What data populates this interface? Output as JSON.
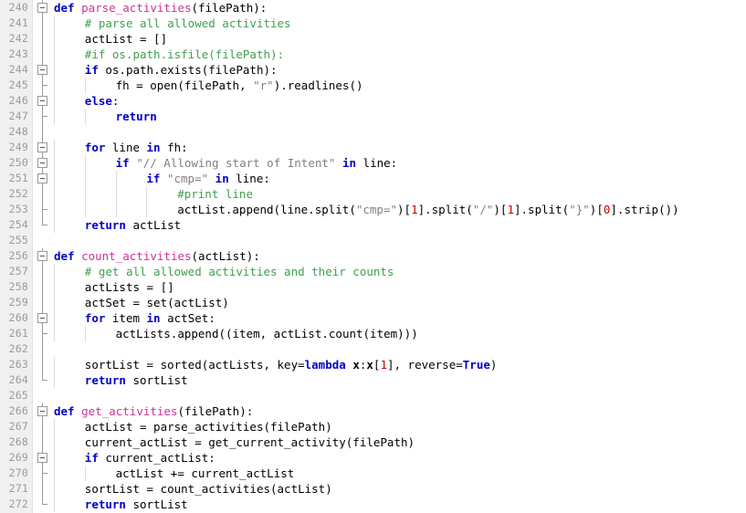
{
  "editor": {
    "name": "code-editor",
    "language": "python",
    "first_line": 240,
    "last_line": 272,
    "line_height_px": 17,
    "colors": {
      "background": "#ffffff",
      "gutter_background": "#f0f0f0",
      "line_number": "#9a9a9a",
      "keyword": "#0000cc",
      "function_name": "#cc3399",
      "comment": "#3f9f4f",
      "string": "#808080",
      "number": "#cc0000",
      "plain_text": "#000000",
      "indent_guide": "#dcdcdc",
      "fold_line": "#999999"
    }
  },
  "lines": [
    {
      "number": "240",
      "indent": 0,
      "fold": "box",
      "tokens": [
        {
          "t": "def ",
          "c": "kw"
        },
        {
          "t": "parse_activities",
          "c": "fname"
        },
        {
          "t": "(filePath):",
          "c": "pln"
        }
      ]
    },
    {
      "number": "241",
      "indent": 1,
      "fold": "line",
      "tokens": [
        {
          "t": "# parse all allowed activities",
          "c": "cmt"
        }
      ]
    },
    {
      "number": "242",
      "indent": 1,
      "fold": "line",
      "tokens": [
        {
          "t": "actList = []",
          "c": "pln"
        }
      ]
    },
    {
      "number": "243",
      "indent": 1,
      "fold": "line",
      "tokens": [
        {
          "t": "#if os.path.isfile(filePath):",
          "c": "cmt"
        }
      ]
    },
    {
      "number": "244",
      "indent": 1,
      "fold": "box",
      "tokens": [
        {
          "t": "if",
          "c": "kw"
        },
        {
          "t": " os.path.exists(filePath):",
          "c": "pln"
        }
      ]
    },
    {
      "number": "245",
      "indent": 2,
      "fold": "tick",
      "tokens": [
        {
          "t": "fh = open(filePath, ",
          "c": "pln"
        },
        {
          "t": "\"r\"",
          "c": "str"
        },
        {
          "t": ").readlines()",
          "c": "pln"
        }
      ]
    },
    {
      "number": "246",
      "indent": 1,
      "fold": "box",
      "tokens": [
        {
          "t": "else",
          "c": "kw"
        },
        {
          "t": ":",
          "c": "pln"
        }
      ]
    },
    {
      "number": "247",
      "indent": 2,
      "fold": "tick",
      "tokens": [
        {
          "t": "return",
          "c": "kw"
        }
      ]
    },
    {
      "number": "248",
      "indent": 0,
      "fold": "line",
      "tokens": []
    },
    {
      "number": "249",
      "indent": 1,
      "fold": "box",
      "tokens": [
        {
          "t": "for",
          "c": "kw"
        },
        {
          "t": " line ",
          "c": "pln"
        },
        {
          "t": "in",
          "c": "kw"
        },
        {
          "t": " fh:",
          "c": "pln"
        }
      ]
    },
    {
      "number": "250",
      "indent": 2,
      "fold": "box",
      "tokens": [
        {
          "t": "if",
          "c": "kw"
        },
        {
          "t": " ",
          "c": "pln"
        },
        {
          "t": "\"// Allowing start of Intent\"",
          "c": "str"
        },
        {
          "t": " ",
          "c": "pln"
        },
        {
          "t": "in",
          "c": "kw"
        },
        {
          "t": " line:",
          "c": "pln"
        }
      ]
    },
    {
      "number": "251",
      "indent": 3,
      "fold": "box",
      "tokens": [
        {
          "t": "if",
          "c": "kw"
        },
        {
          "t": " ",
          "c": "pln"
        },
        {
          "t": "\"cmp=\"",
          "c": "str"
        },
        {
          "t": " ",
          "c": "pln"
        },
        {
          "t": "in",
          "c": "kw"
        },
        {
          "t": " line:",
          "c": "pln"
        }
      ]
    },
    {
      "number": "252",
      "indent": 4,
      "fold": "line",
      "tokens": [
        {
          "t": "#print line",
          "c": "cmt"
        }
      ]
    },
    {
      "number": "253",
      "indent": 4,
      "fold": "tick",
      "tokens": [
        {
          "t": "actList.append(line.split(",
          "c": "pln"
        },
        {
          "t": "\"cmp=\"",
          "c": "str"
        },
        {
          "t": ")[",
          "c": "pln"
        },
        {
          "t": "1",
          "c": "num"
        },
        {
          "t": "].split(",
          "c": "pln"
        },
        {
          "t": "\"/\"",
          "c": "str"
        },
        {
          "t": ")[",
          "c": "pln"
        },
        {
          "t": "1",
          "c": "num"
        },
        {
          "t": "].split(",
          "c": "pln"
        },
        {
          "t": "\"}\"",
          "c": "str"
        },
        {
          "t": ")[",
          "c": "pln"
        },
        {
          "t": "0",
          "c": "num"
        },
        {
          "t": "].strip())",
          "c": "pln"
        }
      ]
    },
    {
      "number": "254",
      "indent": 1,
      "fold": "end",
      "tokens": [
        {
          "t": "return",
          "c": "kw"
        },
        {
          "t": " actList",
          "c": "pln"
        }
      ]
    },
    {
      "number": "255",
      "indent": 0,
      "fold": "none",
      "tokens": []
    },
    {
      "number": "256",
      "indent": 0,
      "fold": "box",
      "tokens": [
        {
          "t": "def ",
          "c": "kw"
        },
        {
          "t": "count_activities",
          "c": "fname"
        },
        {
          "t": "(actList):",
          "c": "pln"
        }
      ]
    },
    {
      "number": "257",
      "indent": 1,
      "fold": "line",
      "tokens": [
        {
          "t": "# get all allowed activities and their counts",
          "c": "cmt"
        }
      ]
    },
    {
      "number": "258",
      "indent": 1,
      "fold": "line",
      "tokens": [
        {
          "t": "actLists = []",
          "c": "pln"
        }
      ]
    },
    {
      "number": "259",
      "indent": 1,
      "fold": "line",
      "tokens": [
        {
          "t": "actSet = set(actList)",
          "c": "pln"
        }
      ]
    },
    {
      "number": "260",
      "indent": 1,
      "fold": "box",
      "tokens": [
        {
          "t": "for",
          "c": "kw"
        },
        {
          "t": " item ",
          "c": "pln"
        },
        {
          "t": "in",
          "c": "kw"
        },
        {
          "t": " actSet:",
          "c": "pln"
        }
      ]
    },
    {
      "number": "261",
      "indent": 2,
      "fold": "tick",
      "tokens": [
        {
          "t": "actLists.append((item, actList.count(item)))",
          "c": "pln"
        }
      ]
    },
    {
      "number": "262",
      "indent": 0,
      "fold": "line",
      "tokens": []
    },
    {
      "number": "263",
      "indent": 1,
      "fold": "line",
      "tokens": [
        {
          "t": "sortList = sorted(actLists, key=",
          "c": "pln"
        },
        {
          "t": "lambda",
          "c": "kw"
        },
        {
          "t": " ",
          "c": "pln"
        },
        {
          "t": "x",
          "c": "bvar"
        },
        {
          "t": ":",
          "c": "pln"
        },
        {
          "t": "x",
          "c": "bvar"
        },
        {
          "t": "[",
          "c": "pln"
        },
        {
          "t": "1",
          "c": "num"
        },
        {
          "t": "], reverse=",
          "c": "pln"
        },
        {
          "t": "True",
          "c": "kw"
        },
        {
          "t": ")",
          "c": "pln"
        }
      ]
    },
    {
      "number": "264",
      "indent": 1,
      "fold": "end",
      "tokens": [
        {
          "t": "return",
          "c": "kw"
        },
        {
          "t": " sortList",
          "c": "pln"
        }
      ]
    },
    {
      "number": "265",
      "indent": 0,
      "fold": "none",
      "tokens": []
    },
    {
      "number": "266",
      "indent": 0,
      "fold": "box",
      "tokens": [
        {
          "t": "def ",
          "c": "kw"
        },
        {
          "t": "get_activities",
          "c": "fname"
        },
        {
          "t": "(filePath):",
          "c": "pln"
        }
      ]
    },
    {
      "number": "267",
      "indent": 1,
      "fold": "line",
      "tokens": [
        {
          "t": "actList = parse_activities(filePath)",
          "c": "pln"
        }
      ]
    },
    {
      "number": "268",
      "indent": 1,
      "fold": "line",
      "tokens": [
        {
          "t": "current_actList = get_current_activity(filePath)",
          "c": "pln"
        }
      ]
    },
    {
      "number": "269",
      "indent": 1,
      "fold": "box",
      "tokens": [
        {
          "t": "if",
          "c": "kw"
        },
        {
          "t": " current_actList:",
          "c": "pln"
        }
      ]
    },
    {
      "number": "270",
      "indent": 2,
      "fold": "tick",
      "tokens": [
        {
          "t": "actList += current_actList",
          "c": "pln"
        }
      ]
    },
    {
      "number": "271",
      "indent": 1,
      "fold": "line",
      "tokens": [
        {
          "t": "sortList = count_activities(actList)",
          "c": "pln"
        }
      ]
    },
    {
      "number": "272",
      "indent": 1,
      "fold": "end",
      "tokens": [
        {
          "t": "return",
          "c": "kw"
        },
        {
          "t": " sortList",
          "c": "pln"
        }
      ]
    }
  ]
}
